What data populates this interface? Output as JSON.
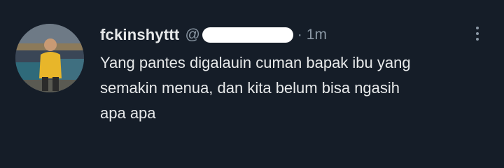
{
  "tweet": {
    "display_name": "fckinshyttt",
    "handle_prefix": "@",
    "separator": "·",
    "timestamp": "1m",
    "text_lines": [
      "Yang pantes digalauin cuman bapak ibu yang",
      "semakin menua, dan kita belum bisa ngasih",
      "apa apa"
    ]
  },
  "icons": {
    "more": "more-vertical-icon"
  },
  "colors": {
    "background": "#151d28",
    "primary_text": "#e7e9ea",
    "secondary_text": "#8b98a5",
    "redaction": "#ffffff"
  }
}
